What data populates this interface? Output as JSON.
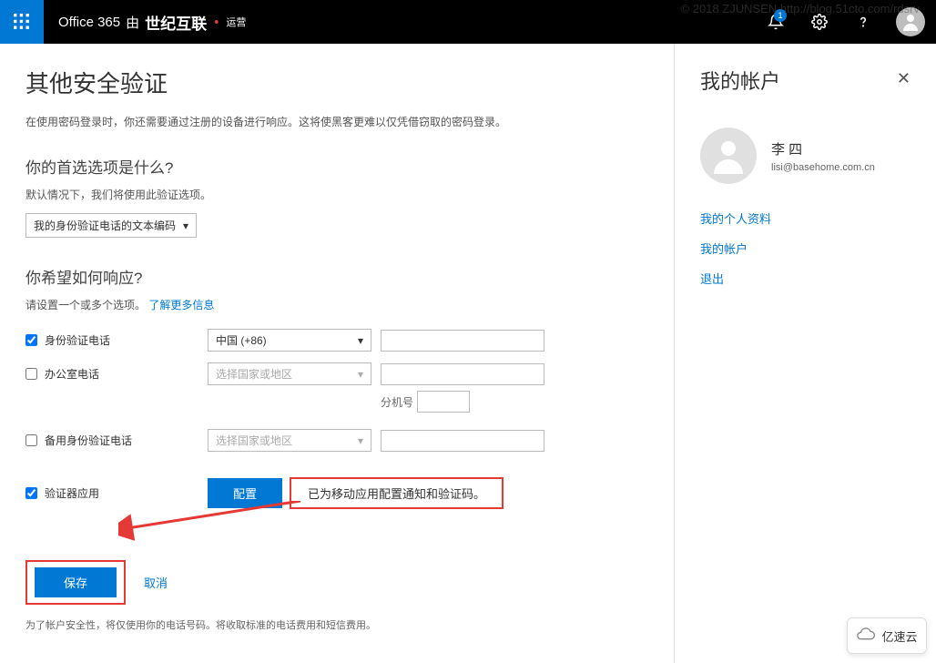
{
  "watermark": "© 2018 ZJUNSEN http://blog.51cto.com/rdsrv",
  "header": {
    "brand_prefix": "Office 365",
    "brand_by": "由",
    "brand_bold": "世纪互联",
    "brand_op": "运营",
    "notification_count": "1"
  },
  "main": {
    "title": "其他安全验证",
    "intro": "在使用密码登录时，你还需要通过注册的设备进行响应。这将使黑客更难以仅凭借窃取的密码登录。",
    "pref_heading": "你的首选选项是什么?",
    "pref_desc": "默认情况下，我们将使用此验证选项。",
    "pref_select": "我的身份验证电话的文本编码",
    "respond_heading": "你希望如何响应?",
    "respond_desc_prefix": "请设置一个或多个选项。",
    "learn_more": "了解更多信息",
    "row_auth_phone": "身份验证电话",
    "row_office_phone": "办公室电话",
    "row_alt_phone": "备用身份验证电话",
    "row_authenticator": "验证器应用",
    "country_china": "中国 (+86)",
    "country_placeholder": "选择国家或地区",
    "ext_label": "分机号",
    "configure_btn": "配置",
    "configured_msg": "已为移动应用配置通知和验证码。",
    "save_btn": "保存",
    "cancel_btn": "取消",
    "footer": "为了帐户安全性，将仅使用你的电话号码。将收取标准的电话费用和短信费用。"
  },
  "sidebar": {
    "title": "我的帐户",
    "user_name": "李 四",
    "user_email": "lisi@basehome.com.cn",
    "links": {
      "profile": "我的个人资料",
      "account": "我的帐户",
      "signout": "退出"
    }
  },
  "logo_badge": "亿速云"
}
